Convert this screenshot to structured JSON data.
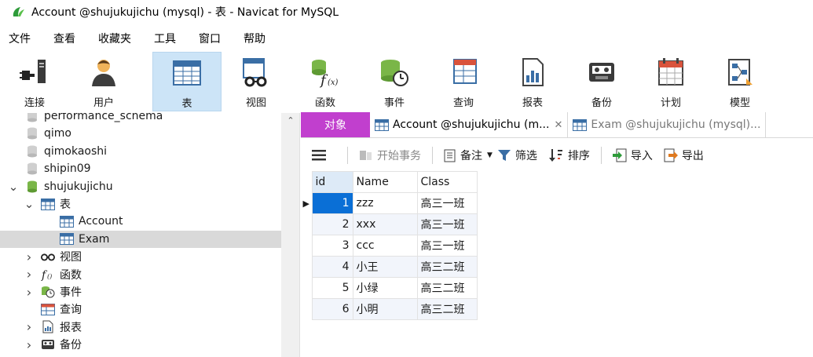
{
  "window": {
    "title": "Account @shujukujichu (mysql) - 表 - Navicat for MySQL"
  },
  "menu": [
    "文件",
    "查看",
    "收藏夹",
    "工具",
    "窗口",
    "帮助"
  ],
  "toolbar": [
    {
      "label": "连接",
      "icon": "connection-icon"
    },
    {
      "label": "用户",
      "icon": "user-icon"
    },
    {
      "label": "表",
      "icon": "table-icon",
      "active": true
    },
    {
      "label": "视图",
      "icon": "view-icon"
    },
    {
      "label": "函数",
      "icon": "function-icon"
    },
    {
      "label": "事件",
      "icon": "event-icon"
    },
    {
      "label": "查询",
      "icon": "query-icon"
    },
    {
      "label": "报表",
      "icon": "report-icon"
    },
    {
      "label": "备份",
      "icon": "backup-icon"
    },
    {
      "label": "计划",
      "icon": "schedule-icon"
    },
    {
      "label": "模型",
      "icon": "model-icon"
    }
  ],
  "tree": [
    {
      "label": "performance_schema",
      "type": "db",
      "indent": 1,
      "chev": ""
    },
    {
      "label": "qimo",
      "type": "db",
      "indent": 1,
      "chev": ""
    },
    {
      "label": "qimokaoshi",
      "type": "db",
      "indent": 1,
      "chev": ""
    },
    {
      "label": "shipin09",
      "type": "db",
      "indent": 1,
      "chev": ""
    },
    {
      "label": "shujukujichu",
      "type": "db-open",
      "indent": 1,
      "chev": "down"
    },
    {
      "label": "表",
      "type": "table-folder",
      "indent": 2,
      "chev": "down"
    },
    {
      "label": "Account",
      "type": "table",
      "indent": 3,
      "chev": ""
    },
    {
      "label": "Exam",
      "type": "table",
      "indent": 3,
      "chev": "",
      "selected": true
    },
    {
      "label": "视图",
      "type": "view",
      "indent": 2,
      "chev": "right"
    },
    {
      "label": "函数",
      "type": "function",
      "indent": 2,
      "chev": "right"
    },
    {
      "label": "事件",
      "type": "event",
      "indent": 2,
      "chev": "right"
    },
    {
      "label": "查询",
      "type": "query",
      "indent": 2,
      "chev": ""
    },
    {
      "label": "报表",
      "type": "report",
      "indent": 2,
      "chev": "right"
    },
    {
      "label": "备份",
      "type": "backup",
      "indent": 2,
      "chev": "right"
    }
  ],
  "tabs": {
    "objects": "对象",
    "active": "Account @shujukujichu (m...",
    "inactive": "Exam @shujukujichu (mysql)..."
  },
  "table_toolbar": {
    "begin_transaction": "开始事务",
    "note": "备注",
    "filter": "筛选",
    "sort": "排序",
    "import": "导入",
    "export": "导出"
  },
  "grid": {
    "columns": [
      "id",
      "Name",
      "Class"
    ],
    "rows": [
      [
        "1",
        "zzz",
        "高三一班"
      ],
      [
        "2",
        "xxx",
        "高三一班"
      ],
      [
        "3",
        "ccc",
        "高三一班"
      ],
      [
        "4",
        "小王",
        "高三二班"
      ],
      [
        "5",
        "小绿",
        "高三二班"
      ],
      [
        "6",
        "小明",
        "高三二班"
      ]
    ]
  },
  "colors": {
    "accent": "#0a6fd6",
    "objects_tab": "#c13fce",
    "toolbar_active": "#cce4f7",
    "db_icon": "#7ab648"
  }
}
